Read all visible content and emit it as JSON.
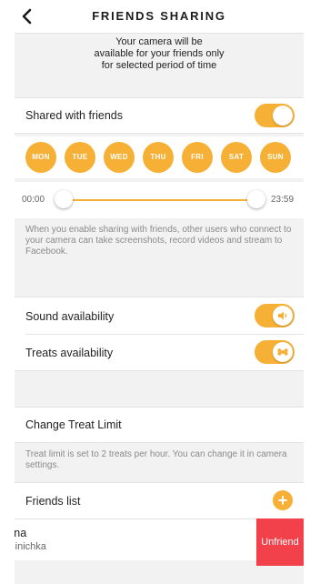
{
  "header": {
    "title": "FRIENDS SHARING",
    "back_icon": "chevron-left-icon"
  },
  "info": {
    "line1": "Your camera will be",
    "line2": "available for your friends only",
    "line3": "for selected period of time"
  },
  "shared": {
    "label": "Shared with friends",
    "enabled": true
  },
  "days": [
    "MON",
    "TUE",
    "WED",
    "THU",
    "FRI",
    "SAT",
    "SUN"
  ],
  "time_range": {
    "start": "00:00",
    "end": "23:59"
  },
  "sharing_note": "When you enable sharing with friends, other users who connect to your camera can take screenshots, record videos and stream to Facebook.",
  "sound": {
    "label": "Sound availability",
    "enabled": true,
    "icon": "speaker-icon"
  },
  "treats": {
    "label": "Treats availability",
    "enabled": true,
    "icon": "bone-icon"
  },
  "treat_limit": {
    "label": "Change Treat Limit",
    "note": "Treat limit is set to 2 treats per hour. You can change it in camera settings."
  },
  "friends": {
    "title": "Friends list",
    "add_symbol": "+",
    "items": [
      {
        "name": "Anna",
        "handle": "@sinichka",
        "action": "Unfriend"
      }
    ]
  },
  "colors": {
    "accent": "#f6b035",
    "danger": "#f2414a",
    "background": "#f2f2f2"
  }
}
